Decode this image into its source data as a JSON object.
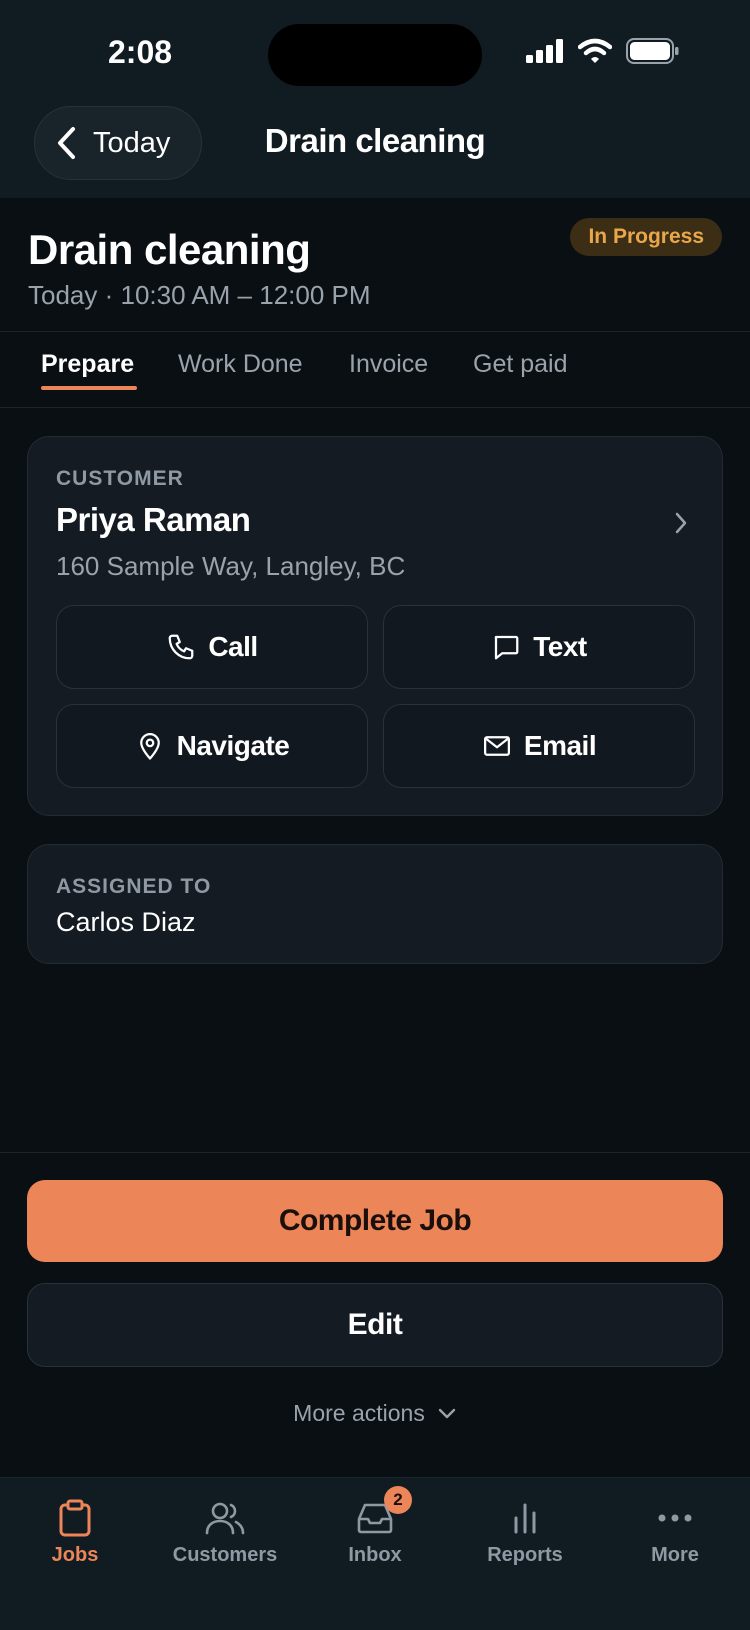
{
  "status_bar": {
    "time": "2:08"
  },
  "nav": {
    "back_label": "Today",
    "title": "Drain cleaning"
  },
  "job": {
    "title": "Drain cleaning",
    "when": "Today · 10:30 AM – 12:00 PM",
    "status": "In Progress",
    "status_color": "#e9a64a"
  },
  "tabs": [
    {
      "label": "Prepare",
      "active": true
    },
    {
      "label": "Work Done"
    },
    {
      "label": "Invoice"
    },
    {
      "label": "Get paid"
    }
  ],
  "customer": {
    "section_label": "CUSTOMER",
    "name": "Priya Raman",
    "address": "160 Sample Way, Langley, BC",
    "actions": {
      "call": "Call",
      "text": "Text",
      "navigate": "Navigate",
      "email": "Email"
    }
  },
  "assignment": {
    "section_label": "ASSIGNED TO",
    "name": "Carlos Diaz"
  },
  "footer_actions": {
    "primary": "Complete Job",
    "secondary": "Edit",
    "more": "More actions"
  },
  "tabbar": {
    "items": [
      {
        "label": "Jobs",
        "icon": "clipboard-icon",
        "active": true
      },
      {
        "label": "Customers",
        "icon": "users-icon"
      },
      {
        "label": "Inbox",
        "icon": "inbox-icon",
        "badge": "2"
      },
      {
        "label": "Reports",
        "icon": "bar-chart-icon"
      },
      {
        "label": "More",
        "icon": "more-icon"
      }
    ]
  },
  "colors": {
    "accent": "#ec8558",
    "background": "#0a0f14",
    "card": "#141b22"
  }
}
